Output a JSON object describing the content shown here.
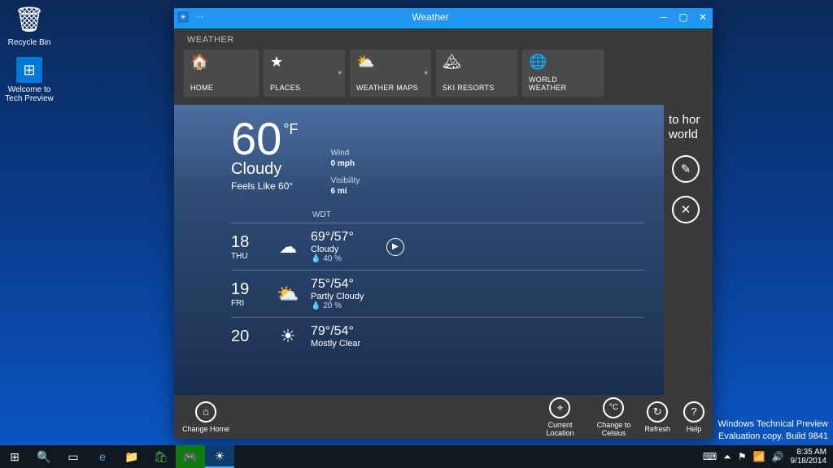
{
  "desktop": {
    "icons": [
      {
        "label": "Recycle Bin",
        "glyph": "🗑"
      },
      {
        "label": "Welcome to Tech Preview",
        "glyph": "⊞"
      }
    ]
  },
  "window": {
    "title": "Weather",
    "section": "WEATHER",
    "tabs": [
      {
        "label": "HOME",
        "icon": "home"
      },
      {
        "label": "PLACES",
        "icon": "star",
        "dropdown": true
      },
      {
        "label": "WEATHER MAPS",
        "icon": "cloud-sun",
        "dropdown": true
      },
      {
        "label": "SKI RESORTS",
        "icon": "mountain"
      },
      {
        "label": "WORLD WEATHER",
        "icon": "globe"
      }
    ]
  },
  "current": {
    "temp": "60",
    "unit": "°F",
    "condition": "Cloudy",
    "feels": "Feels Like 60°",
    "wind_label": "Wind",
    "wind": "0 mph",
    "vis_label": "Visibility",
    "vis": "6 mi",
    "tz": "WDT"
  },
  "forecast": [
    {
      "date": "18",
      "day": "THU",
      "hi_lo": "69°/57°",
      "cond": "Cloudy",
      "precip": "💧 40 %",
      "icon": "☁"
    },
    {
      "date": "19",
      "day": "FRI",
      "hi_lo": "75°/54°",
      "cond": "Partly Cloudy",
      "precip": "💧 20 %",
      "icon": "⛅"
    },
    {
      "date": "20",
      "day": "",
      "hi_lo": "79°/54°",
      "cond": "Mostly Clear",
      "precip": "",
      "icon": "☀"
    }
  ],
  "sidepanel": {
    "line1": "to hor",
    "line2": "world"
  },
  "appbar": {
    "change_home": "Change Home",
    "location": "Current Location",
    "celsius": "Change to Celsius",
    "refresh": "Refresh",
    "help": "Help"
  },
  "watermark": {
    "line1": "Windows Technical Preview",
    "line2": "Evaluation copy. Build 9841"
  },
  "clock": {
    "time": "8:35 AM",
    "date": "9/18/2014"
  }
}
